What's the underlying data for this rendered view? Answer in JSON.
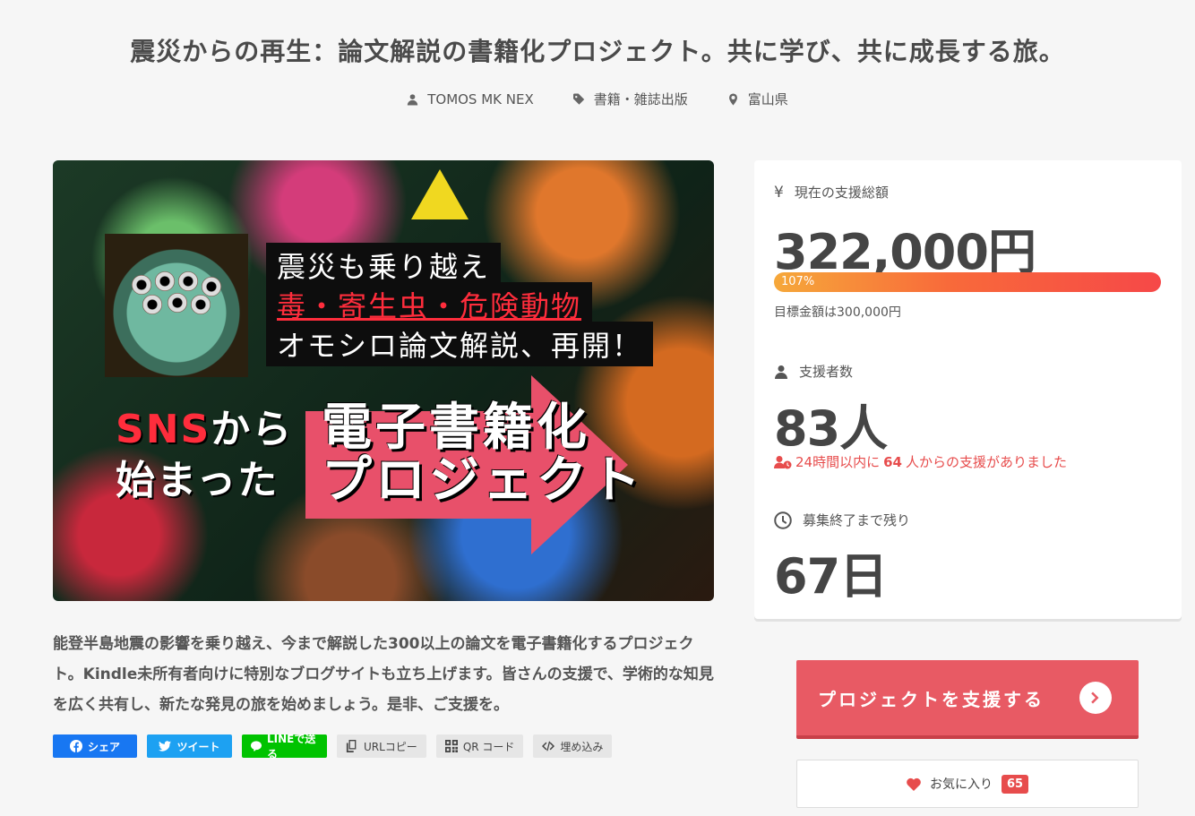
{
  "header": {
    "title": "震災からの再生：論文解説の書籍化プロジェクト。共に学び、共に成長する旅。",
    "author": "TOMOS MK NEX",
    "category": "書籍・雑誌出版",
    "location": "富山県"
  },
  "hero": {
    "line1": "震災も乗り越え",
    "line2": "毒・寄生虫・危険動物",
    "line3": "オモシロ論文解説、再開！",
    "sns_red": "SNS",
    "sns_rest": "から",
    "started": "始まった",
    "big1": "電子書籍化",
    "big2": "プロジェクト"
  },
  "description": "能登半島地震の影響を乗り越え、今まで解説した300以上の論文を電子書籍化するプロジェクト。Kindle未所有者向けに特別なブログサイトも立ち上げます。皆さんの支援で、学術的な知見を広く共有し、新たな発見の旅を始めましょう。是非、ご支援を。",
  "share": {
    "facebook": "シェア",
    "twitter": "ツイート",
    "line": "LINEで送る",
    "url_copy": "URLコピー",
    "qr": "QR コード",
    "embed": "埋め込み"
  },
  "stats": {
    "total_label": "現在の支援総額",
    "total_symbol": "¥",
    "total_value": "322,000円",
    "progress_text": "107%",
    "progress_percent": 107,
    "goal_text": "目標金額は300,000円",
    "backers_label": "支援者数",
    "backers_value": "83人",
    "recent_prefix": "24時間以内に",
    "recent_count": "64",
    "recent_suffix": "人からの支援がありました",
    "remaining_label": "募集終了まで残り",
    "remaining_value": "67日"
  },
  "actions": {
    "support_label": "プロジェクトを支援する",
    "favorite_label": "お気に入り",
    "favorite_count": "65"
  },
  "colors": {
    "accent": "#e85a64",
    "facebook": "#1877f2",
    "twitter": "#1da1f2",
    "line": "#00c300"
  }
}
